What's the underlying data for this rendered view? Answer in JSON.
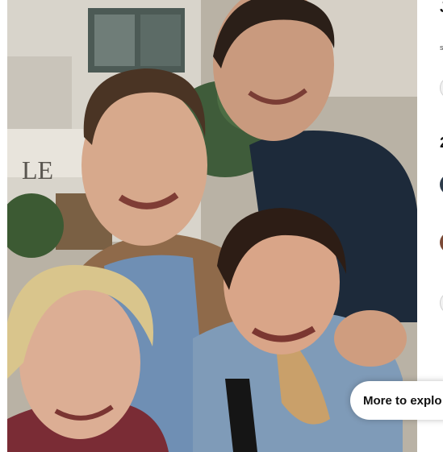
{
  "photo": {
    "sign_fragment": "LE"
  },
  "sidebar": {
    "top_glyph": "J",
    "small_text": "s",
    "number_glyph": "2"
  },
  "explore": {
    "label": "More to explo"
  }
}
